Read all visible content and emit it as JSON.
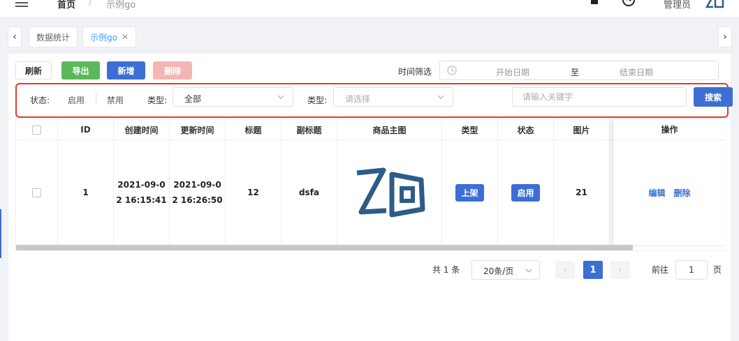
{
  "header": {
    "breadcrumb_home": "首页",
    "breadcrumb_sep": "/",
    "breadcrumb_current": "示例go",
    "user": "管理员"
  },
  "tabs": [
    {
      "label": "数据统计",
      "active": false
    },
    {
      "label": "示例go",
      "active": true
    }
  ],
  "toolbar": {
    "refresh": "刷新",
    "export": "导出",
    "add": "新增",
    "delete": "删除",
    "time_label": "时间筛选",
    "start_placeholder": "开始日期",
    "to": "至",
    "end_placeholder": "结束日期"
  },
  "filters": {
    "status_label": "状态:",
    "enable": "启用",
    "disable": "禁用",
    "type1_label": "类型:",
    "type1_value": "全部",
    "type2_label": "类型:",
    "type2_placeholder": "请选择",
    "keyword_placeholder": "请输入关键字",
    "search": "搜索"
  },
  "table": {
    "columns": [
      "ID",
      "创建时间",
      "更新时间",
      "标题",
      "副标题",
      "商品主图",
      "类型",
      "状态",
      "图片",
      "操作"
    ],
    "rows": [
      {
        "id": "1",
        "created_1": "2021-09-0",
        "created_2": "2 16:15:41",
        "updated_1": "2021-09-0",
        "updated_2": "2 16:26:50",
        "title": "12",
        "subtitle": "dsfa",
        "type": "上架",
        "status": "启用",
        "image": "21",
        "edit": "编辑",
        "delete": "删除"
      }
    ]
  },
  "pagination": {
    "total": "共 1 条",
    "page_size": "20条/页",
    "current": "1",
    "goto": "前往",
    "goto_value": "1",
    "page_unit": "页"
  },
  "colors": {
    "primary": "#3b6fd4",
    "success": "#5cb85c",
    "danger_light": "#f5b5b5",
    "highlight_border": "#e03b2a",
    "logo": "#2c5c88"
  },
  "icons": [
    "menu-icon",
    "bell-icon",
    "palette-icon",
    "logo",
    "chevron-left-icon",
    "chevron-right-icon",
    "close-icon",
    "clock-icon",
    "chevron-down-icon"
  ]
}
